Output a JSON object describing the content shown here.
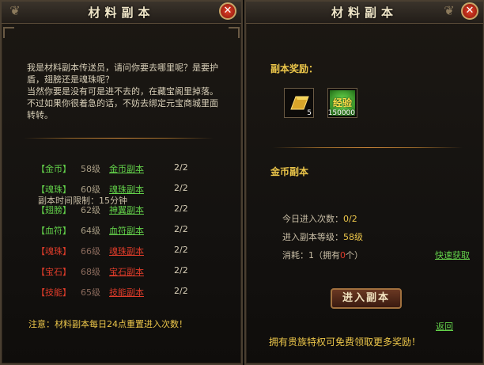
{
  "colors": {
    "green": "#63d14a",
    "red": "#e03c2a",
    "gold": "#ecc64a",
    "text": "#d8cfb8"
  },
  "left_panel": {
    "title": "材料副本",
    "intro": "我是材料副本传送员，请问你要去哪里呢？是要护盾，翅膀还是魂珠呢？\n当然你要是没有可是进不去的，在藏宝阁里掉落。不过如果你很着急的话，不妨去绑定元宝商城里面转转。",
    "rows": [
      {
        "category": "【金币】",
        "level": "58级",
        "instance": "金币副本",
        "count": "2/2",
        "state": "green"
      },
      {
        "category": "【魂珠】",
        "level": "60级",
        "instance": "魂珠副本",
        "count": "2/2",
        "state": "green"
      },
      {
        "category": "【翅膀】",
        "level": "62级",
        "instance": "神翼副本",
        "count": "2/2",
        "state": "green"
      },
      {
        "category": "【血符】",
        "level": "64级",
        "instance": "血符副本",
        "count": "2/2",
        "state": "green"
      },
      {
        "category": "【魂珠】",
        "level": "66级",
        "instance": "魂珠副本",
        "count": "2/2",
        "state": "red"
      },
      {
        "category": "【宝石】",
        "level": "68级",
        "instance": "宝石副本",
        "count": "2/2",
        "state": "red"
      },
      {
        "category": "【技能】",
        "level": "65级",
        "instance": "技能副本",
        "count": "2/2",
        "state": "red"
      }
    ],
    "notice": "注意：材料副本每日24点重置进入次数！"
  },
  "right_panel": {
    "title": "材料副本",
    "reward_heading": "副本奖励：",
    "rewards": [
      {
        "icon": "gold-bar-icon",
        "qty": "5"
      },
      {
        "icon": "exp-icon",
        "label": "经验",
        "qty": "150000"
      }
    ],
    "instance_name": "金币副本",
    "info": {
      "time_label": "副本时间限制：",
      "time_value": "15分钟",
      "today_label": "今日进入次数：",
      "today_value": "0/2",
      "level_label": "进入副本等级：",
      "level_value": "58级",
      "cost_prefix": "消耗：1（拥有",
      "cost_owned": "0",
      "cost_suffix": "个）"
    },
    "quick_get": "快速获取",
    "enter_button": "进入副本",
    "back": "返回",
    "bottom_text": "拥有贵族特权可免费领取更多奖励！"
  }
}
